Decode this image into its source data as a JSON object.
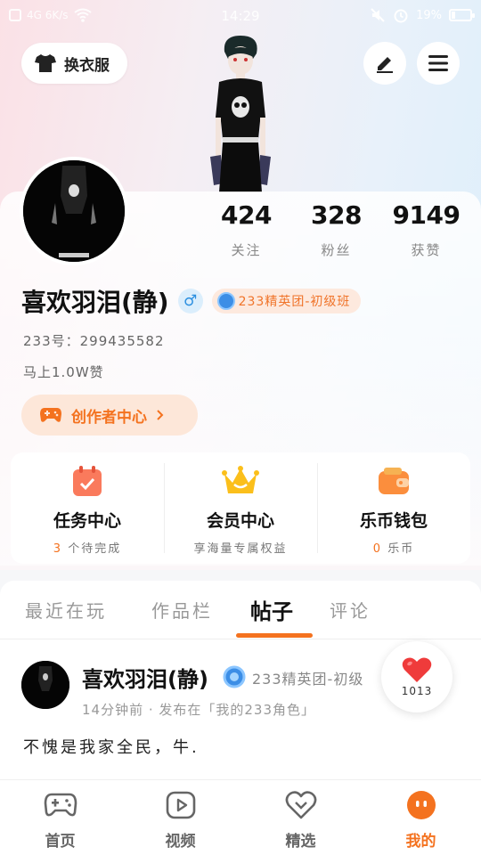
{
  "status_bar": {
    "carrier": "4G 6K/s",
    "time": "14:29",
    "battery": "19%",
    "battery_level": 0.19
  },
  "header": {
    "outfit_label": "换衣服"
  },
  "profile": {
    "username": "喜欢羽泪(静)",
    "gender_symbol": "♂",
    "badge": "233精英团-初级班",
    "uid": "233号：299435582",
    "likes_hint": "马上1.0W赞",
    "creator_center_label": "创作者中心",
    "stats": [
      {
        "value": "424",
        "label": "关注"
      },
      {
        "value": "328",
        "label": "粉丝"
      },
      {
        "value": "9149",
        "label": "获赞"
      }
    ]
  },
  "features": [
    {
      "title": "任务中心",
      "highlight": "3",
      "sub": "个待完成",
      "icon": "calendar-check-icon"
    },
    {
      "title": "会员中心",
      "highlight": "",
      "sub": "享海量专属权益",
      "icon": "crown-icon"
    },
    {
      "title": "乐币钱包",
      "highlight": "0",
      "sub": "乐币",
      "icon": "wallet-icon"
    }
  ],
  "tabs": [
    "最近在玩",
    "作品栏",
    "帖子",
    "评论"
  ],
  "active_tab": 2,
  "post": {
    "author": "喜欢羽泪(静)",
    "badge": "233精英团-初级",
    "meta": "14分钟前 · 发布在「我的233角色」",
    "text": "不愧是我家全民，牛."
  },
  "like_float": {
    "count": "1013"
  },
  "bottom_nav": [
    {
      "label": "首页",
      "icon": "gamepad-icon"
    },
    {
      "label": "视频",
      "icon": "play-icon"
    },
    {
      "label": "精选",
      "icon": "heart-badge-icon"
    },
    {
      "label": "我的",
      "icon": "profile-face-icon"
    }
  ],
  "colors": {
    "accent": "#f4721f",
    "badge_bg": "#fde9de",
    "gender_bg": "#dbeefc",
    "like_red": "#ef3b3b"
  }
}
